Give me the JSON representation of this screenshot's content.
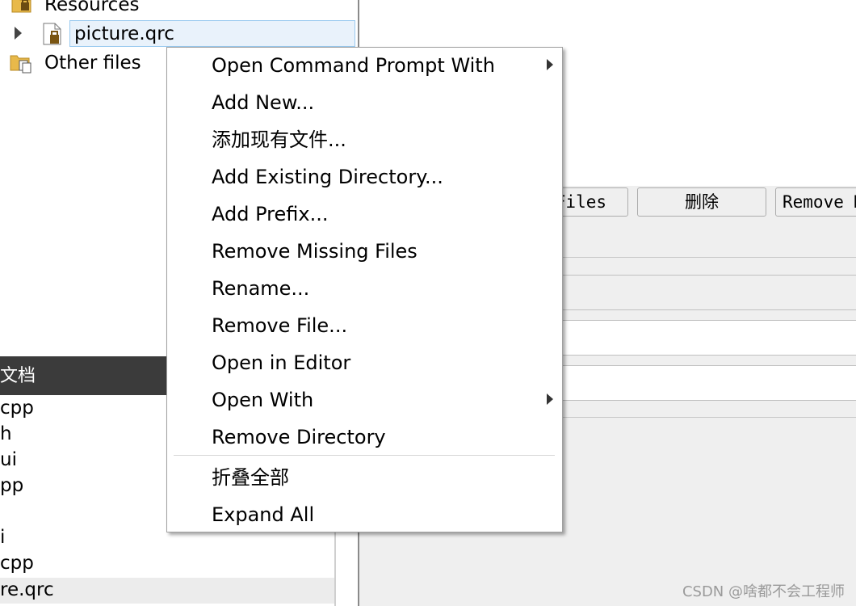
{
  "tree": {
    "resources_label": "Resources",
    "qrc_file": "picture.qrc",
    "other_files": "Other files"
  },
  "open_docs": {
    "header": "文档",
    "items": [
      "cpp",
      "h",
      "ui",
      "pp",
      "i",
      "cpp",
      "re.qrc"
    ]
  },
  "editor_buttons": {
    "files_partial": "Files",
    "delete": "删除",
    "remove_partial": "Remove M"
  },
  "context_menu": {
    "items": [
      {
        "label": "Open Command Prompt With",
        "submenu": true
      },
      {
        "label": "Add New...",
        "submenu": false
      },
      {
        "label": "添加现有文件...",
        "submenu": false
      },
      {
        "label": "Add Existing Directory...",
        "submenu": false
      },
      {
        "label": "Add Prefix...",
        "submenu": false
      },
      {
        "label": "Remove Missing Files",
        "submenu": false
      },
      {
        "label": "Rename...",
        "submenu": false
      },
      {
        "label": "Remove File...",
        "submenu": false
      },
      {
        "label": "Open in Editor",
        "submenu": false
      },
      {
        "label": "Open With",
        "submenu": true
      },
      {
        "label": "Remove Directory",
        "submenu": false
      },
      {
        "label": "折叠全部",
        "submenu": false
      },
      {
        "label": "Expand All",
        "submenu": false
      }
    ]
  },
  "watermark": "CSDN @啥都不会工程师",
  "colors": {
    "docs_header_bg": "#3b3b3b",
    "selection_bg": "#e9f2fb",
    "selection_border": "#99c9ef",
    "panel_bg": "#efefef"
  }
}
